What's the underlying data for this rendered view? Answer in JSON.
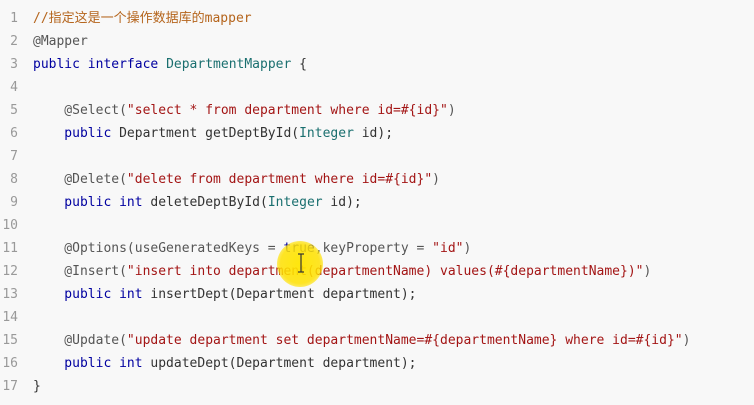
{
  "editor": {
    "lines": [
      {
        "n": "1",
        "tokens": [
          {
            "t": "//指定这是一个操作数据库的mapper",
            "c": "cm"
          }
        ]
      },
      {
        "n": "2",
        "tokens": [
          {
            "t": "@Mapper",
            "c": "an"
          }
        ]
      },
      {
        "n": "3",
        "tokens": [
          {
            "t": "public ",
            "c": "kw"
          },
          {
            "t": "interface ",
            "c": "kw"
          },
          {
            "t": "DepartmentMapper",
            "c": "ty"
          },
          {
            "t": " {",
            "c": "pl"
          }
        ]
      },
      {
        "n": "4",
        "tokens": []
      },
      {
        "n": "5",
        "tokens": [
          {
            "t": "    @Select(",
            "c": "an"
          },
          {
            "t": "\"select * from department where id=#{id}\"",
            "c": "str"
          },
          {
            "t": ")",
            "c": "an"
          }
        ]
      },
      {
        "n": "6",
        "tokens": [
          {
            "t": "    public ",
            "c": "kw"
          },
          {
            "t": "Department getDeptById(",
            "c": "pl"
          },
          {
            "t": "Integer",
            "c": "ty"
          },
          {
            "t": " id);",
            "c": "pl"
          }
        ]
      },
      {
        "n": "7",
        "tokens": []
      },
      {
        "n": "8",
        "tokens": [
          {
            "t": "    @Delete(",
            "c": "an"
          },
          {
            "t": "\"delete from department where id=#{id}\"",
            "c": "str"
          },
          {
            "t": ")",
            "c": "an"
          }
        ]
      },
      {
        "n": "9",
        "tokens": [
          {
            "t": "    public ",
            "c": "kw"
          },
          {
            "t": "int",
            "c": "kw"
          },
          {
            "t": " deleteDeptById(",
            "c": "pl"
          },
          {
            "t": "Integer",
            "c": "ty"
          },
          {
            "t": " id);",
            "c": "pl"
          }
        ]
      },
      {
        "n": "10",
        "tokens": []
      },
      {
        "n": "11",
        "tokens": [
          {
            "t": "    @Options(useGeneratedKeys = ",
            "c": "an"
          },
          {
            "t": "true",
            "c": "kw"
          },
          {
            "t": ",keyProperty = ",
            "c": "an"
          },
          {
            "t": "\"id\"",
            "c": "str"
          },
          {
            "t": ")",
            "c": "an"
          }
        ]
      },
      {
        "n": "12",
        "tokens": [
          {
            "t": "    @Insert(",
            "c": "an"
          },
          {
            "t": "\"insert into department(departmentName) values(#{departmentName})\"",
            "c": "str"
          },
          {
            "t": ")",
            "c": "an"
          }
        ]
      },
      {
        "n": "13",
        "tokens": [
          {
            "t": "    public ",
            "c": "kw"
          },
          {
            "t": "int",
            "c": "kw"
          },
          {
            "t": " insertDept(Department department);",
            "c": "pl"
          }
        ]
      },
      {
        "n": "14",
        "tokens": []
      },
      {
        "n": "15",
        "tokens": [
          {
            "t": "    @Update(",
            "c": "an"
          },
          {
            "t": "\"update department set departmentName=#{departmentName} where id=#{id}\"",
            "c": "str"
          },
          {
            "t": ")",
            "c": "an"
          }
        ]
      },
      {
        "n": "16",
        "tokens": [
          {
            "t": "    public ",
            "c": "kw"
          },
          {
            "t": "int",
            "c": "kw"
          },
          {
            "t": " updateDept(Department department);",
            "c": "pl"
          }
        ]
      },
      {
        "n": "17",
        "tokens": [
          {
            "t": "}",
            "c": "pl"
          }
        ]
      }
    ]
  },
  "colors": {
    "background": "#f8f8f8",
    "line_number": "#999999",
    "keyword": "#0000a0",
    "type": "#1a6f6f",
    "string": "#a31515",
    "comment": "#b5651d",
    "cursor_highlight": "#ffe600"
  },
  "icons": {
    "cursor": "i-beam-cursor-icon"
  }
}
